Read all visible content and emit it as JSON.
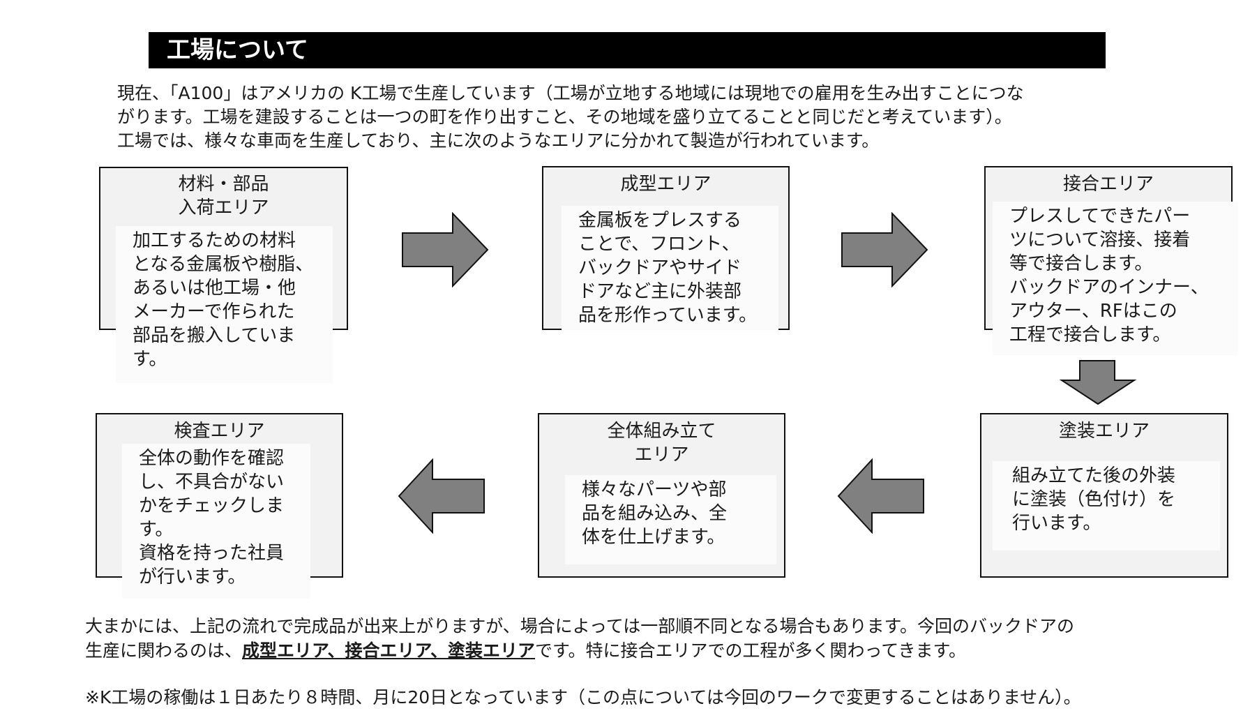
{
  "header": {
    "title": "工場について"
  },
  "intro": {
    "line1": "現在、「A100」はアメリカの K工場で生産しています（工場が立地する地域には現地での雇用を生み出すことにつな",
    "line2": "がります。工場を建設することは一つの町を作り出すこと、その地域を盛り立てることと同じだと考えています）。",
    "line3": "工場では、様々な車両を生産しており、主に次のようなエリアに分かれて製造が行われています。"
  },
  "areas": [
    {
      "title": "材料・部品\n入荷エリア",
      "text": "加工するための材料\nとなる金属板や樹脂、\nあるいは他工場・他\nメーカーで作られた\n部品を搬入していま\nす。"
    },
    {
      "title": "成型エリア",
      "text": "金属板をプレスする\nことで、フロント、\nバックドアやサイド\nドアなど主に外装部\n品を形作っています。"
    },
    {
      "title": "接合エリア",
      "text": "プレスしてできたパー\nツについて溶接、接着\n等で接合します。\nバックドアのインナー、\nアウター、RFはこの\n工程で接合します。"
    },
    {
      "title": "塗装エリア",
      "text": "組み立てた後の外装\nに塗装（色付け）を\n行います。"
    },
    {
      "title": "全体組み立て\nエリア",
      "text": "様々なパーツや部\n品を組み込み、全\n体を仕上げます。"
    },
    {
      "title": "検査エリア",
      "text": "全体の動作を確認\nし、不具合がない\nかをチェックしま\nす。\n資格を持った社員\nが行います。"
    }
  ],
  "summary": {
    "line1": "大まかには、上記の流れで完成品が出来上がりますが、場合によっては一部順不同となる場合もあります。今回のバックドアの",
    "line2_prefix": "生産に関わるのは、",
    "line2_emph": "成型エリア、接合エリア、塗装エリア",
    "line2_suffix": "です。特に接合エリアでの工程が多く関わってきます。"
  },
  "note": "※K工場の稼働は１日あたり８時間、月に20日となっています（この点については今回のワークで変更することはありません）。",
  "colors": {
    "banner": "#000000",
    "box_fill": "#f2f2f2",
    "arrow_fill": "#808080"
  }
}
